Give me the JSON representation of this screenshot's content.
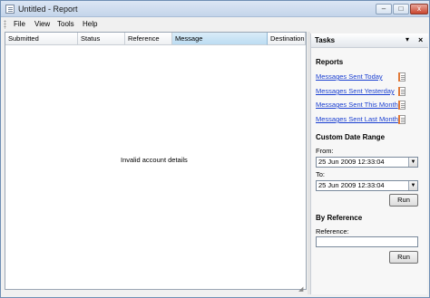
{
  "window": {
    "title": "Untitled - Report",
    "minimize_label": "–",
    "maximize_label": "□",
    "close_label": "x"
  },
  "menu": {
    "items": [
      {
        "label": "File"
      },
      {
        "label": "View"
      },
      {
        "label": "Tools"
      },
      {
        "label": "Help"
      }
    ]
  },
  "table": {
    "columns": [
      "Submitted",
      "Status",
      "Reference",
      "Message",
      "Destination"
    ],
    "empty_message": "Invalid account details"
  },
  "tasks": {
    "title": "Tasks",
    "dropdown_glyph": "▾",
    "close_glyph": "×",
    "reports": {
      "title": "Reports",
      "links": [
        {
          "label": "Messages Sent Today"
        },
        {
          "label": "Messages Sent Yesterday"
        },
        {
          "label": "Messages Sent This Month"
        },
        {
          "label": "Messages Sent Last Month"
        }
      ]
    },
    "custom_range": {
      "title": "Custom Date Range",
      "from_label": "From:",
      "from_value": "25 Jun  2009 12:33:04",
      "to_label": "To:",
      "to_value": "25 Jun  2009 12:33:04",
      "run_label": "Run"
    },
    "by_reference": {
      "title": "By Reference",
      "reference_label": "Reference:",
      "reference_value": "",
      "run_label": "Run"
    }
  }
}
